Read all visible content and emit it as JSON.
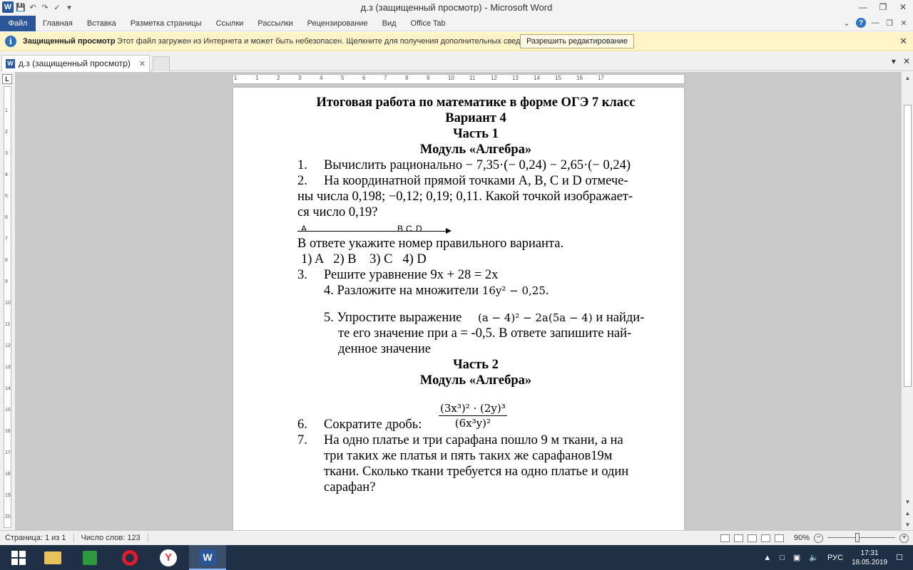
{
  "window": {
    "title": "д.з (защищенный просмотр)  -  Microsoft Word",
    "app_letter": "W"
  },
  "ribbon": {
    "tabs": [
      "Файл",
      "Главная",
      "Вставка",
      "Разметка страницы",
      "Ссылки",
      "Рассылки",
      "Рецензирование",
      "Вид",
      "Office Tab"
    ]
  },
  "protected_view": {
    "label": "Защищенный просмотр",
    "message": "Этот файл загружен из Интернета и может быть небезопасен. Щелкните для получения дополнительных сведений.",
    "enable_button": "Разрешить редактирование",
    "info_glyph": "i"
  },
  "doc_tab": {
    "name": "д.з (защищенный просмотр)"
  },
  "ruler": {
    "corner": "L",
    "numbers": [
      "1",
      "1",
      "2",
      "3",
      "4",
      "5",
      "6",
      "7",
      "8",
      "9",
      "10",
      "11",
      "12",
      "13",
      "14",
      "15",
      "16",
      "17"
    ]
  },
  "document": {
    "title": "Итоговая работа по математике в форме ОГЭ 7 класс",
    "variant": "Вариант 4",
    "part1": "Часть 1",
    "module1": "Модуль «Алгебра»",
    "q1_num": "1.",
    "q1_text": "Вычислить рационально",
    "q1_expr": "− 7,35·(− 0,24) − 2,65·(− 0,24)",
    "q2_num": "2.",
    "q2_line1": "На координатной прямой точками A, B, C и D отмече-",
    "q2_line2": "ны числа 0,198; −0,12; 0,19; 0,11. Какой точкой изображает-",
    "q2_line3": "ся число 0,19?",
    "axis_points": [
      "A",
      "B",
      "C",
      "D"
    ],
    "answer_prompt": "В ответе укажите номер правильного варианта.",
    "options": "1) A   2) B    3) C   4) D",
    "q3_num": "3.",
    "q3_text": "Решите уравнение 9x + 28 = 2x",
    "q4_text": "4. Разложите на множители",
    "q4_expr": "16y² − 0,25",
    "q4_end": ".",
    "q5_text": "5. Упростите выражение",
    "q5_expr": "(a − 4)² − 2a(5a − 4)",
    "q5_tail1": "и найди-",
    "q5_line2": "те его значение при а = -0,5. В ответе запишите най-",
    "q5_line3": "денное значение",
    "part2": "Часть 2",
    "module2": "Модуль «Алгебра»",
    "q6_num": "6.",
    "q6_text": "Сократите дробь:",
    "q6_numerator": "(3x³)² · (2y)³",
    "q6_denominator": "(6x³y)²",
    "q7_num": "7.",
    "q7_line1": "На одно платье и три сарафана пошло 9 м ткани, а на",
    "q7_line2": "три таких же платья и пять таких же сарафанов19м",
    "q7_line3": "ткани. Сколько ткани требуется на одно платье и один",
    "q7_line4": "сарафан?"
  },
  "status": {
    "page": "Страница: 1 из 1",
    "words": "Число слов: 123",
    "zoom": "90%",
    "zoom_percent": 90
  },
  "taskbar": {
    "lang": "РУС",
    "time": "17:31",
    "date": "18.05.2019"
  }
}
